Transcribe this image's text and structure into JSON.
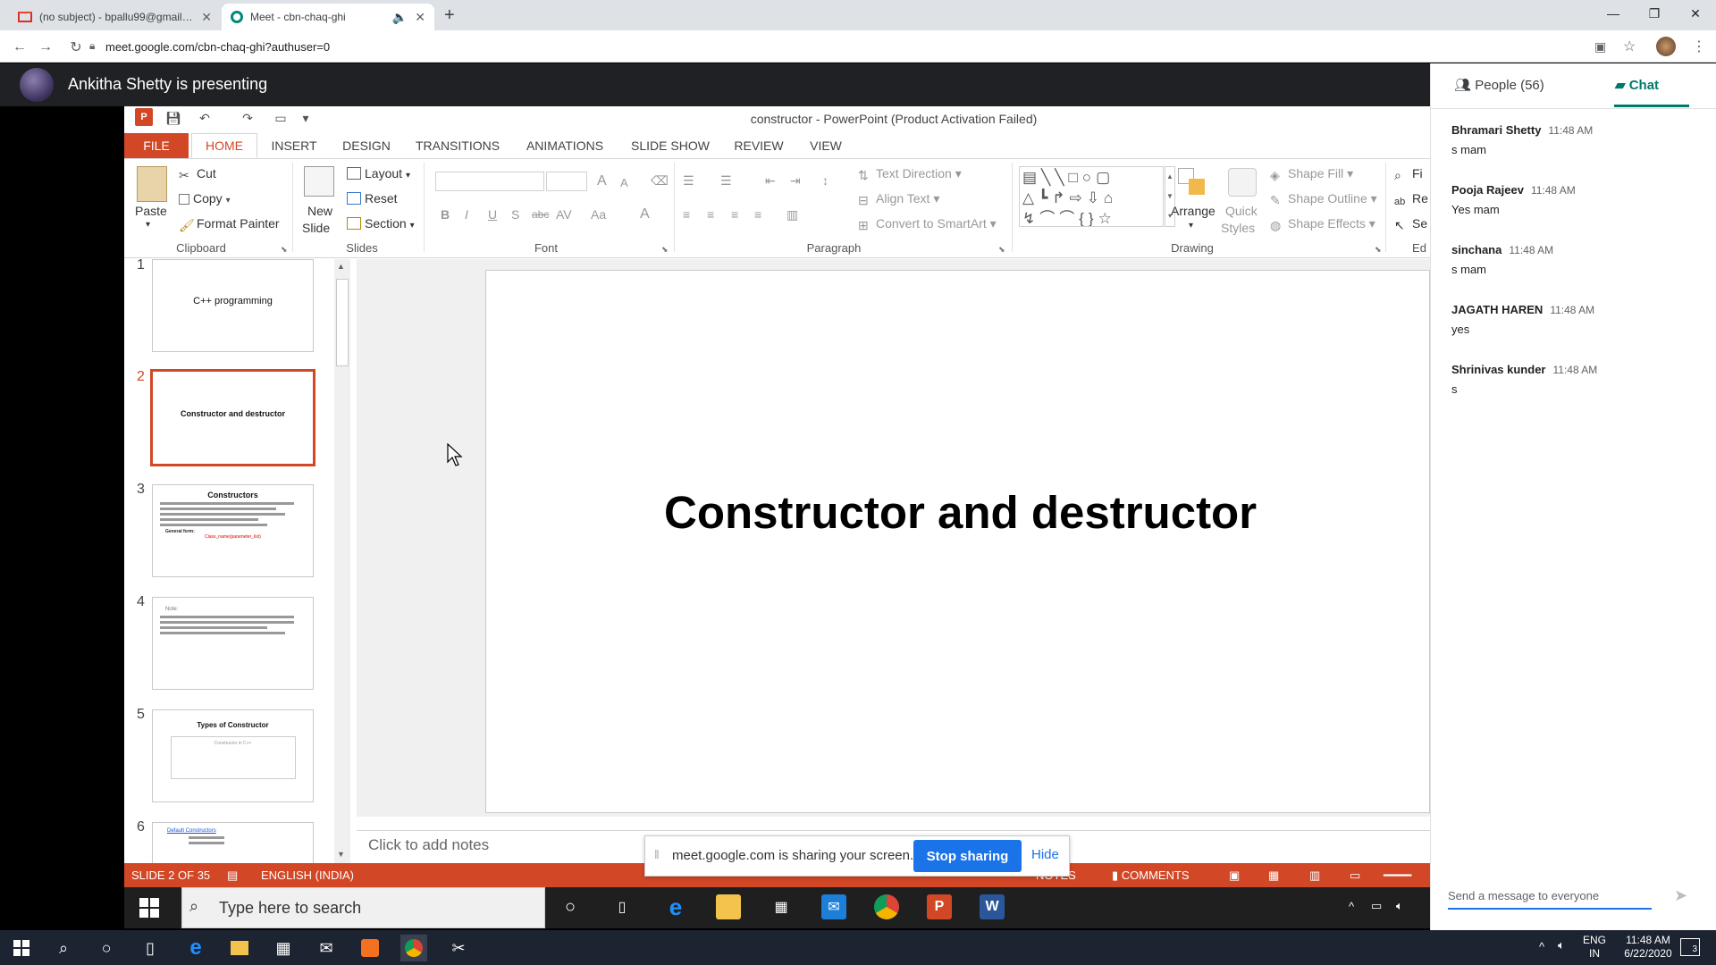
{
  "browser": {
    "tabs": [
      {
        "title": "(no subject) - bpallu99@gmail.co",
        "close": "✕"
      },
      {
        "title": "Meet - cbn-chaq-ghi",
        "close": "✕",
        "audio": "🔈"
      }
    ],
    "new_tab": "+",
    "window_controls": {
      "minimize": "—",
      "restore": "❐",
      "close": "✕"
    },
    "url": "meet.google.com/cbn-chaq-ghi?authuser=0"
  },
  "meet": {
    "presenter_text": "Ankitha Shetty is presenting",
    "sidebar": {
      "people_label": "People (56)",
      "chat_label": "Chat",
      "messages": [
        {
          "name": "Bhramari Shetty",
          "time": "11:48 AM",
          "text": "s mam"
        },
        {
          "name": "Pooja Rajeev",
          "time": "11:48 AM",
          "text": "Yes mam"
        },
        {
          "name": "sinchana",
          "time": "11:48 AM",
          "text": "s mam"
        },
        {
          "name": "JAGATH HAREN",
          "time": "11:48 AM",
          "text": "yes"
        },
        {
          "name": "Shrinivas kunder",
          "time": "11:48 AM",
          "text": "s"
        }
      ],
      "send_placeholder": "Send a message to everyone"
    },
    "share_bar": {
      "text": "meet.google.com is sharing your screen.",
      "stop_label": "Stop sharing",
      "hide_label": "Hide"
    }
  },
  "powerpoint": {
    "window_title": "constructor - PowerPoint (Product Activation Failed)",
    "logo_text": "P",
    "ribbon_tabs": [
      "FILE",
      "HOME",
      "INSERT",
      "DESIGN",
      "TRANSITIONS",
      "ANIMATIONS",
      "SLIDE SHOW",
      "REVIEW",
      "VIEW"
    ],
    "clipboard": {
      "paste": "Paste",
      "cut": "Cut",
      "copy": "Copy",
      "format_painter": "Format Painter",
      "group": "Clipboard"
    },
    "slides_group": {
      "new_slide": "New",
      "new_slide_2": "Slide",
      "layout": "Layout",
      "reset": "Reset",
      "section": "Section",
      "group": "Slides"
    },
    "font_group": {
      "group": "Font",
      "bold": "B",
      "italic": "I",
      "underline": "U",
      "shadow": "S",
      "strike": "abc",
      "spacing": "AV",
      "case": "Aa",
      "color": "A",
      "grow": "A",
      "shrink": "A"
    },
    "paragraph_group": {
      "group": "Paragraph",
      "text_direction": "Text Direction",
      "align_text": "Align Text",
      "convert_smartart": "Convert to SmartArt"
    },
    "drawing_group": {
      "group": "Drawing",
      "arrange": "Arrange",
      "quick_styles": "Quick",
      "quick_styles_2": "Styles",
      "shape_fill": "Shape Fill",
      "shape_outline": "Shape Outline",
      "shape_effects": "Shape Effects"
    },
    "editing_group": {
      "group": "Ed",
      "find": "Fi",
      "replace": "Re",
      "select": "Se"
    },
    "thumbnails": [
      {
        "num": "1",
        "title": "C++ programming"
      },
      {
        "num": "2",
        "title": "Constructor and destructor"
      },
      {
        "num": "3",
        "title": "Constructors",
        "note": "General form:",
        "red": "Class_name(parameter_list)"
      },
      {
        "num": "4",
        "title": "Note:"
      },
      {
        "num": "5",
        "title": "Types of Constructor",
        "diagram": "Constructor in C++"
      },
      {
        "num": "6",
        "title": "Default Constructors"
      }
    ],
    "slide_title": "Constructor and destructor",
    "notes_placeholder": "Click to add notes",
    "status": {
      "slide": "SLIDE 2 OF 35",
      "language": "ENGLISH (INDIA)",
      "notes": "NOTES",
      "comments": "COMMENTS"
    }
  },
  "inner_taskbar": {
    "search_placeholder": "Type here to search"
  },
  "os_taskbar": {
    "lang": "ENG",
    "region": "IN",
    "time": "11:48 AM",
    "date": "6/22/2020",
    "notif_count": "3"
  },
  "colors": {
    "ppt_accent": "#d24726",
    "meet_green": "#00796b",
    "link_blue": "#1a73e8"
  }
}
